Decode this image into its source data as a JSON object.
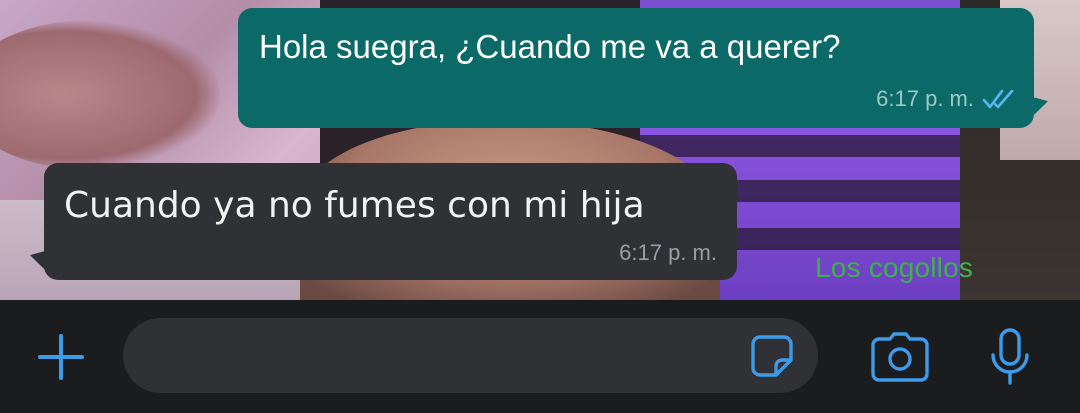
{
  "conversation": {
    "outgoing": {
      "text": "Hola suegra, ¿Cuando me va a querer?",
      "time": "6:17 p. m.",
      "status_icon": "double-check-icon"
    },
    "incoming": {
      "text": "Cuando ya no fumes con mi hija",
      "time": "6:17 p. m."
    },
    "watermark": "Los cogollos"
  },
  "composer": {
    "placeholder": "",
    "icons": [
      "plus-icon",
      "sticker-icon",
      "camera-icon",
      "microphone-icon"
    ],
    "accent_color": "#3d9be9"
  },
  "colors": {
    "outgoing_bubble": "#0b6a68",
    "incoming_bubble": "#2f3134",
    "composer_bg": "#1a1c1e",
    "watermark": "#3bb24a"
  }
}
